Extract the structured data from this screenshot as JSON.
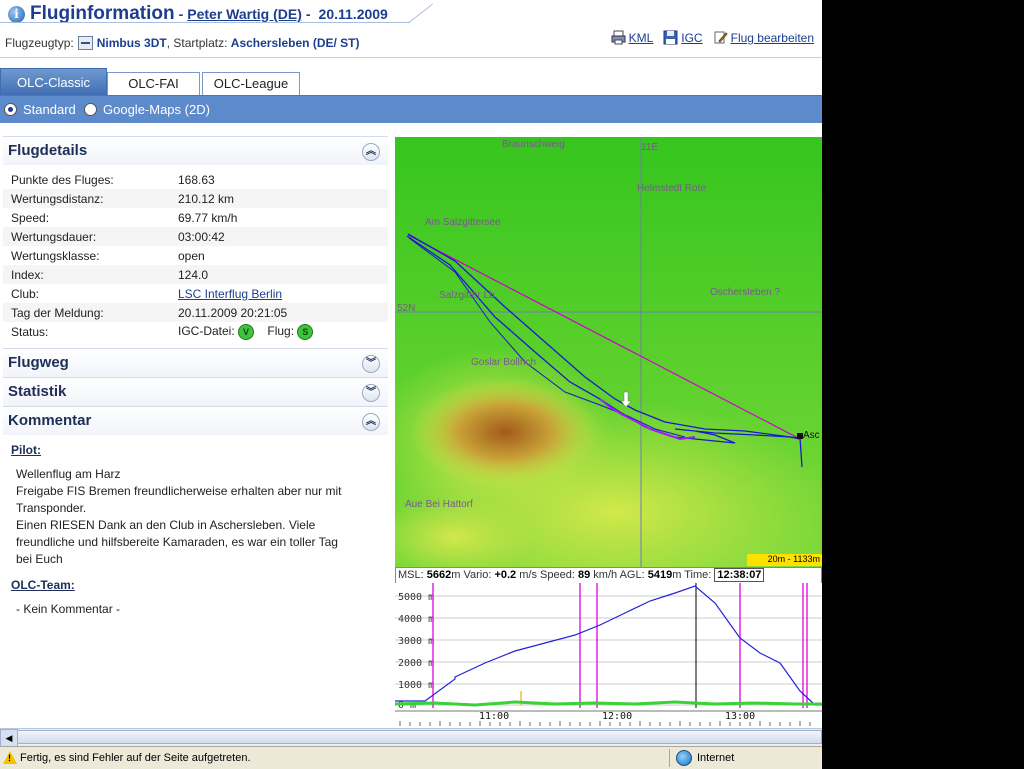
{
  "header": {
    "title": "Fluginformation",
    "separator": "-",
    "pilot": "Peter Wartig (DE)",
    "date_sep": "-",
    "date": "20.11.2009",
    "aircraft_label": "Flugzeugtyp:",
    "aircraft": "Nimbus 3DT",
    "start_label": ", Startplatz:",
    "start": "Aschersleben (DE/ ST)",
    "links": {
      "kml": "KML",
      "igc": "IGC",
      "edit": "Flug bearbeiten"
    }
  },
  "tabs": [
    {
      "label": "OLC-Classic",
      "active": true
    },
    {
      "label": "OLC-FAI",
      "active": false
    },
    {
      "label": "OLC-League",
      "active": false
    }
  ],
  "view_options": {
    "standard": "Standard",
    "google": "Google-Maps (2D)"
  },
  "sections": {
    "details": "Flugdetails",
    "route": "Flugweg",
    "stats": "Statistik",
    "comment": "Kommentar"
  },
  "details": {
    "points_label": "Punkte des Fluges:",
    "points": "168.63",
    "distance_label": "Wertungsdistanz:",
    "distance": "210.12 km",
    "speed_label": "Speed:",
    "speed": "69.77 km/h",
    "duration_label": "Wertungsdauer:",
    "duration": "03:00:42",
    "class_label": "Wertungsklasse:",
    "class": "open",
    "index_label": "Index:",
    "index": "124.0",
    "club_label": "Club:",
    "club": "LSC Interflug Berlin",
    "reported_label": "Tag der Meldung:",
    "reported": "20.11.2009 20:21:05",
    "status_label": "Status:",
    "igc_label": "IGC-Datei:",
    "igc_badge": "V",
    "flight_label": "Flug:",
    "flight_badge": "S"
  },
  "comment": {
    "pilot_heading": "Pilot:",
    "pilot_lines": [
      "Wellenflug am Harz",
      "Freigabe FIS Bremen freundlicherweise erhalten aber nur mit",
      "Transponder.",
      "Einen RIESEN Dank an den Club in Aschersleben. Viele",
      "freundliche und hilfsbereite Kamaraden, es war ein toller Tag",
      "bei Euch"
    ],
    "team_heading": "OLC-Team:",
    "team_text": "- Kein Kommentar -"
  },
  "map": {
    "labels": {
      "braunschweig": "Braunschweig",
      "lon": "11E",
      "helmstedt": "Helmstedt Rote",
      "salzgittersee": "Am Salzgittersee",
      "salzgitter": "Salzgitter Lb.",
      "lat": "52N",
      "oschersleben": "Oschersleben ?",
      "goslar": "Goslar Bollrich",
      "aue": "Aue Bei Hattorf",
      "asch": "Asc"
    },
    "scale": "20m - 1133m"
  },
  "telemetry": {
    "msl_label": "MSL:",
    "msl": "5662",
    "msl_unit": "m",
    "vario_label": "Vario:",
    "vario": "+0.2",
    "vario_unit": "m/s",
    "speed_label": "Speed:",
    "speed": "89",
    "speed_unit": "km/h",
    "agl_label": "AGL:",
    "agl": "5419",
    "agl_unit": "m",
    "time_label": "Time:",
    "time": "12:38:07"
  },
  "barogram": {
    "y_labels": [
      "5000 m",
      "4000 m",
      "3000 m",
      "2000 m",
      "1000 m",
      "0 m"
    ],
    "x_labels": [
      "11:00",
      "12:00",
      "13:00"
    ]
  },
  "status_bar": {
    "message": "Fertig, es sind Fehler auf der Seite aufgetreten.",
    "zone": "Internet"
  },
  "colors": {
    "title": "#1d3e8f",
    "tab_active": "#4f7ec0",
    "bar": "#5c8acb",
    "track": "#1a1acc",
    "task": "#d000d0"
  }
}
